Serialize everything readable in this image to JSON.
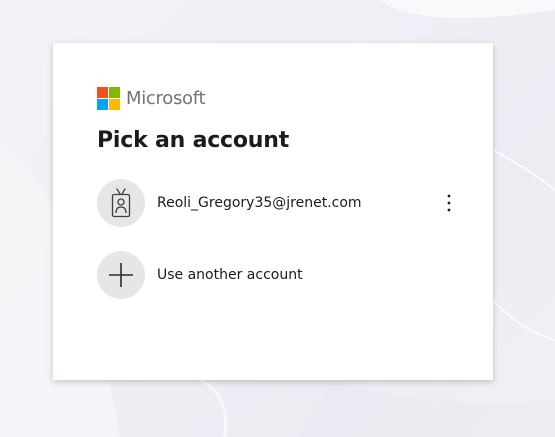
{
  "brand": {
    "name": "Microsoft",
    "logo_colors": [
      "#f25022",
      "#7fba00",
      "#00a4ef",
      "#ffb900"
    ]
  },
  "title": "Pick an account",
  "accounts": [
    {
      "email": "Reoli_Gregory35@jrenet.com",
      "avatar_icon": "badge-icon",
      "menu_icon": "more-vertical-icon"
    }
  ],
  "use_another": {
    "label": "Use another account",
    "icon": "plus-icon"
  }
}
